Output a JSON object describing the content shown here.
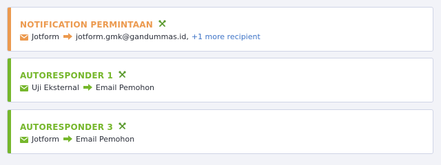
{
  "colors": {
    "orange": "#ec9a4f",
    "green": "#76b72c",
    "link": "#3f74c7",
    "text": "#2b2f3a"
  },
  "emails": [
    {
      "title": "NOTIFICATION PERMINTAAN",
      "accent": "orange",
      "from": "Jotform",
      "to": "jotform.gmk@gandummas.id,",
      "more": "+1 more recipient",
      "icons": [
        "tools-icon",
        "mail-icon",
        "arrow-right-icon"
      ]
    },
    {
      "title": "AUTORESPONDER 1",
      "accent": "green",
      "from": "Uji Eksternal",
      "to": "Email Pemohon",
      "icons": [
        "tools-icon",
        "mail-icon",
        "arrow-right-icon"
      ]
    },
    {
      "title": "AUTORESPONDER 3",
      "accent": "green",
      "from": "Jotform",
      "to": "Email Pemohon",
      "icons": [
        "tools-icon",
        "mail-icon",
        "arrow-right-icon"
      ]
    }
  ]
}
